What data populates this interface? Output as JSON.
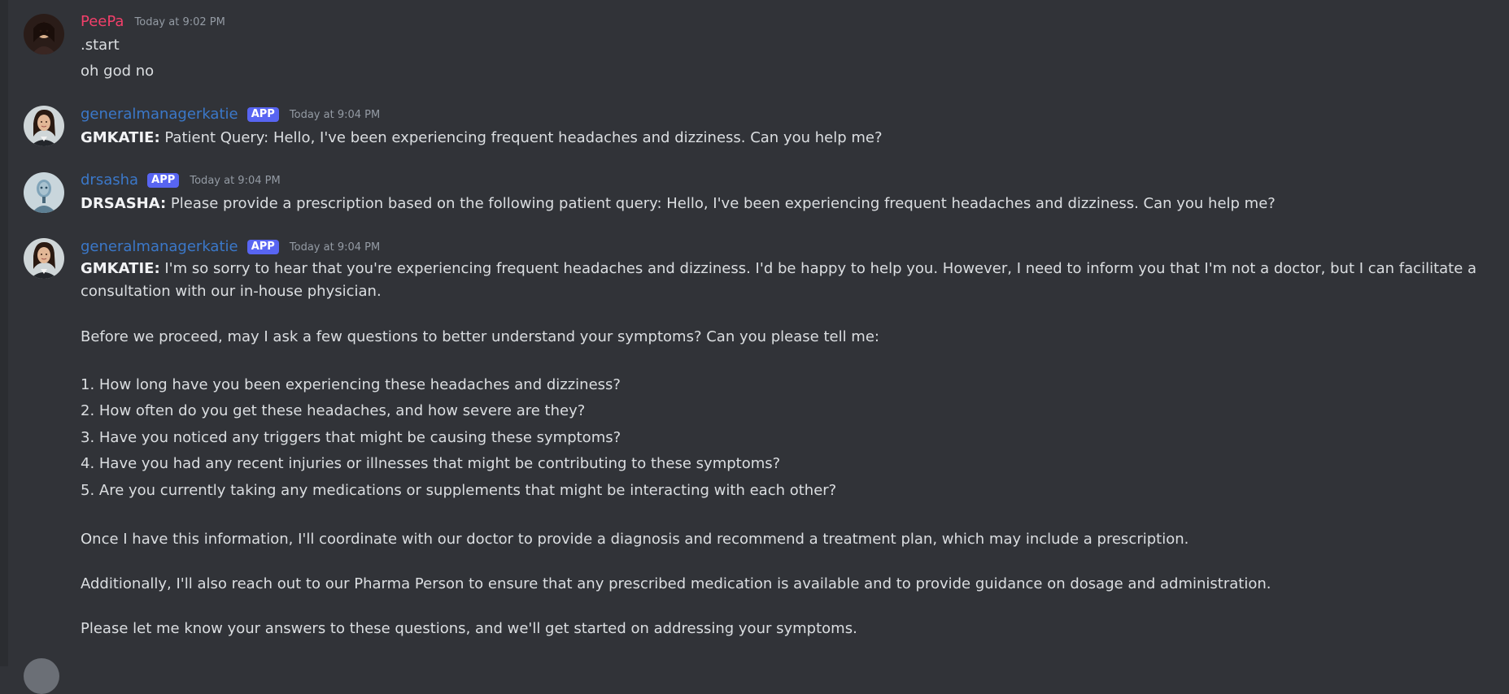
{
  "colors": {
    "background": "#313338",
    "text": "#dbdee1",
    "timestamp": "#949ba4",
    "peepa_name": "#f23f6a",
    "bot_name": "#3b78c9",
    "badge": "#5865f2"
  },
  "messages": [
    {
      "username": "PeePa",
      "timestamp": "Today at 9:02 PM",
      "lines": [
        ".start",
        "oh god no"
      ]
    },
    {
      "username": "generalmanagerkatie",
      "badge": "APP",
      "timestamp": "Today at 9:04 PM",
      "prefix": "GMKATIE:",
      "text": " Patient Query: Hello, I've been experiencing frequent headaches and dizziness. Can you help me?"
    },
    {
      "username": "drsasha",
      "badge": "APP",
      "timestamp": "Today at 9:04 PM",
      "prefix": "DRSASHA:",
      "text": " Please provide a prescription based on the following patient query: Hello, I've been experiencing frequent headaches and dizziness. Can you help me?"
    },
    {
      "username": "generalmanagerkatie",
      "badge": "APP",
      "timestamp": "Today at 9:04 PM",
      "prefix": "GMKATIE:",
      "intro": " I'm so sorry to hear that you're experiencing frequent headaches and dizziness. I'd be happy to help you. However, I need to inform you that I'm not a doctor, but I can facilitate a consultation with our in-house physician.",
      "question_lead": "Before we proceed, may I ask a few questions to better understand your symptoms? Can you please tell me:",
      "questions": [
        "1. How long have you been experiencing these headaches and dizziness?",
        "2. How often do you get these headaches, and how severe are they?",
        "3. Have you noticed any triggers that might be causing these symptoms?",
        "4. Have you had any recent injuries or illnesses that might be contributing to these symptoms?",
        "5. Are you currently taking any medications or supplements that might be interacting with each other?"
      ],
      "closing": [
        "Once I have this information, I'll coordinate with our doctor to provide a diagnosis and recommend a treatment plan, which may include a prescription.",
        "Additionally, I'll also reach out to our Pharma Person to ensure that any prescribed medication is available and to provide guidance on dosage and administration.",
        "Please let me know your answers to these questions, and we'll get started on addressing your symptoms."
      ]
    }
  ]
}
